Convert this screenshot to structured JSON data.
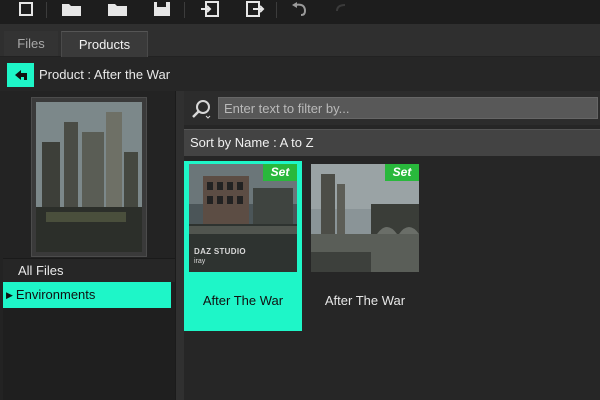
{
  "toolbar": {
    "buttons": [
      {
        "icon": "new-icon"
      },
      {
        "icon": "open-folder-icon"
      },
      {
        "icon": "merge-folder-icon"
      },
      {
        "icon": "save-icon"
      },
      {
        "icon": "import-icon"
      },
      {
        "icon": "export-icon"
      },
      {
        "icon": "undo-icon"
      },
      {
        "icon": "redo-icon"
      }
    ]
  },
  "tabs": [
    {
      "label": "Files",
      "active": false
    },
    {
      "label": "Products",
      "active": true
    }
  ],
  "product": {
    "prefix": "Product : ",
    "name": "After the War"
  },
  "tree": {
    "all_files": "All Files",
    "environments": "Environments"
  },
  "filter": {
    "placeholder": "Enter text to filter by..."
  },
  "sort": {
    "label": "Sort by Name : A to Z"
  },
  "cards": [
    {
      "label": "After The War",
      "badge": "Set",
      "brand_line1": "DAZ STUDIO",
      "brand_line2": "iray",
      "selected": true
    },
    {
      "label": "After The War",
      "badge": "Set",
      "selected": false
    }
  ],
  "colors": {
    "accent": "#1ef6c8",
    "set_badge": "#29b83c",
    "background": "#2b2b2b"
  }
}
